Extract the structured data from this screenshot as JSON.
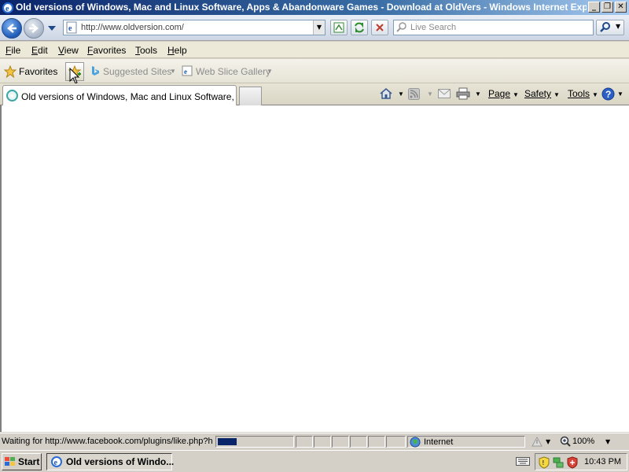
{
  "window": {
    "title": "Old versions of Windows, Mac and Linux Software, Apps & Abandonware Games - Download at OldVers - Windows Internet Explo...",
    "buttons": [
      "minimize",
      "restore",
      "close"
    ]
  },
  "address_bar": {
    "url": "http://www.oldversion.com/",
    "search_placeholder": "Live Search"
  },
  "menu": [
    "File",
    "Edit",
    "View",
    "Favorites",
    "Tools",
    "Help"
  ],
  "favorites_bar": {
    "favorites_label": "Favorites",
    "links": [
      "Suggested Sites",
      "Web Slice Gallery"
    ]
  },
  "tab": {
    "label": "Old versions of Windows, Mac and Linux Software, A..."
  },
  "command_bar": {
    "page": "Page",
    "safety": "Safety",
    "tools": "Tools"
  },
  "status_bar": {
    "text": "Waiting for http://www.facebook.com/plugins/like.php?h",
    "progress": 0.25,
    "zone": "Internet",
    "zoom": "100%"
  },
  "taskbar": {
    "start_label": "Start",
    "task_label": "Old versions of Windo...",
    "clock": "10:43 PM"
  },
  "colors": {
    "titlebar_start": "#0a246a",
    "titlebar_end": "#a6caf0",
    "chrome_bg": "#d4d0c8",
    "progress_fill": "#0a246a"
  }
}
